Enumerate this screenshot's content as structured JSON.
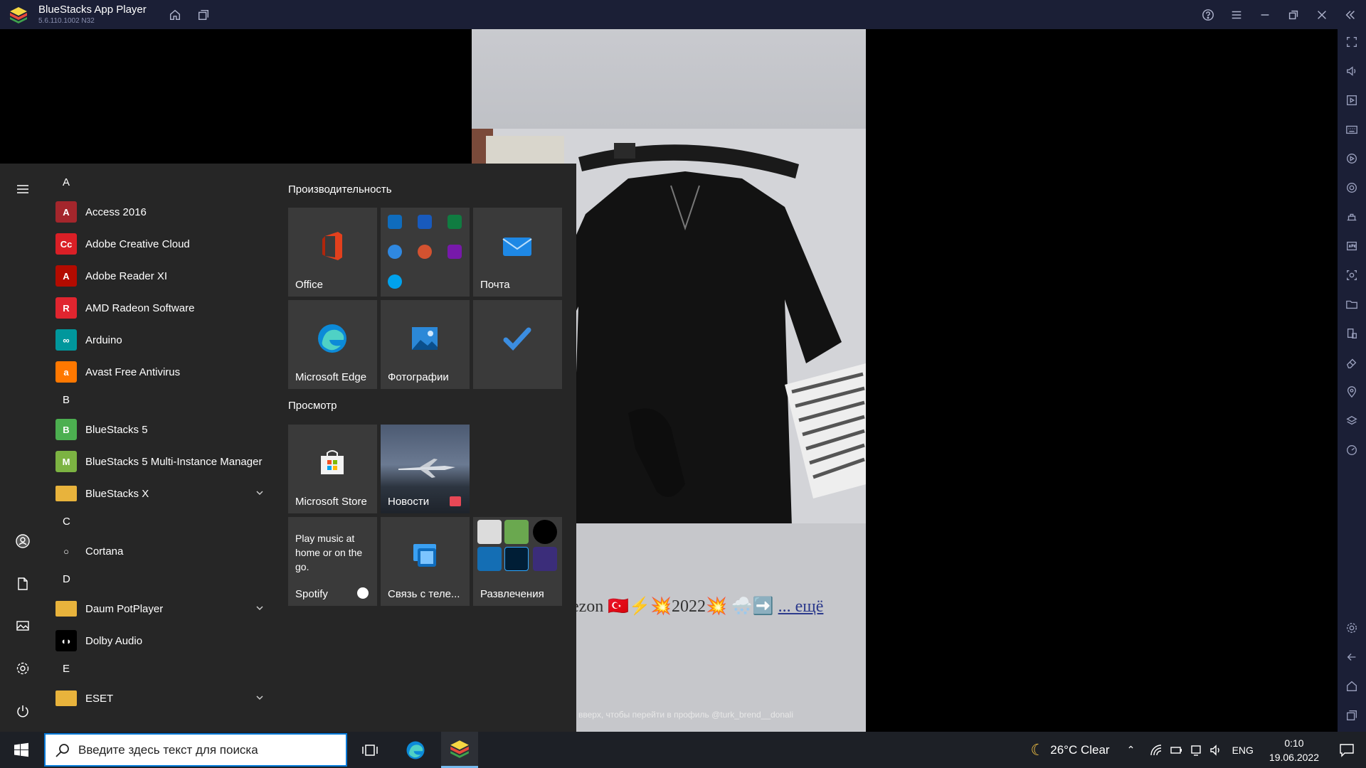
{
  "window": {
    "title": "BlueStacks App Player",
    "version": "5.6.110.1002  N32"
  },
  "emulator": {
    "caption_text": "ezon 🇹🇷⚡💥2022💥 🌨️➡️",
    "caption_more": "... ещё",
    "swipe_hint": "вверх, чтобы перейти в профиль @turk_brend__donali"
  },
  "start_menu": {
    "apps": [
      {
        "type": "letter",
        "text": "A"
      },
      {
        "type": "app",
        "label": "Access 2016",
        "icon": "access-icon",
        "color": "#a4262c",
        "glyph": "A"
      },
      {
        "type": "app",
        "label": "Adobe Creative Cloud",
        "icon": "creative-cloud-icon",
        "color": "#da1f26",
        "glyph": "Cc"
      },
      {
        "type": "app",
        "label": "Adobe Reader XI",
        "icon": "adobe-reader-icon",
        "color": "#b30b00",
        "glyph": "A"
      },
      {
        "type": "app",
        "label": "AMD Radeon Software",
        "icon": "amd-radeon-icon",
        "color": "#e0252f",
        "glyph": "R"
      },
      {
        "type": "app",
        "label": "Arduino",
        "icon": "arduino-icon",
        "color": "#00979c",
        "glyph": "∞"
      },
      {
        "type": "app",
        "label": "Avast Free Antivirus",
        "icon": "avast-icon",
        "color": "#ff7800",
        "glyph": "a"
      },
      {
        "type": "letter",
        "text": "B"
      },
      {
        "type": "app",
        "label": "BlueStacks 5",
        "icon": "bluestacks-icon",
        "color": "#4caf50",
        "glyph": "B"
      },
      {
        "type": "app",
        "label": "BlueStacks 5 Multi-Instance Manager",
        "icon": "bluestacks-mim-icon",
        "color": "#7cb342",
        "glyph": "M"
      },
      {
        "type": "folder",
        "label": "BlueStacks X",
        "icon": "folder-icon",
        "color": "#e8b33c",
        "glyph": ""
      },
      {
        "type": "letter",
        "text": "C"
      },
      {
        "type": "app",
        "label": "Cortana",
        "icon": "cortana-icon",
        "color": "#262626",
        "glyph": "○"
      },
      {
        "type": "letter",
        "text": "D"
      },
      {
        "type": "folder",
        "label": "Daum PotPlayer",
        "icon": "folder-icon",
        "color": "#e8b33c",
        "glyph": ""
      },
      {
        "type": "app",
        "label": "Dolby Audio",
        "icon": "dolby-icon",
        "color": "#000000",
        "glyph": "◖◗"
      },
      {
        "type": "letter",
        "text": "E"
      },
      {
        "type": "folder",
        "label": "ESET",
        "icon": "folder-icon",
        "color": "#e8b33c",
        "glyph": ""
      }
    ],
    "groups": [
      {
        "title": "Производительность"
      },
      {
        "title": "Просмотр"
      }
    ],
    "tiles": {
      "office": "Office",
      "mail": "Почта",
      "edge": "Microsoft Edge",
      "photos": "Фотографии",
      "store": "Microsoft Store",
      "news": "Новости",
      "spotify_desc": "Play music at home or on the go.",
      "spotify": "Spotify",
      "phone": "Связь с теле...",
      "entertainment": "Развлечения"
    }
  },
  "taskbar": {
    "search_placeholder": "Введите здесь текст для поиска",
    "weather": "26°C  Clear",
    "language": "ENG",
    "time": "0:10",
    "date": "19.06.2022"
  },
  "colors": {
    "titlebar": "#1b1f36",
    "start_bg": "#262626",
    "tile_bg": "#3a3a3a",
    "taskbar": "#1d2026",
    "accent": "#0078d7"
  }
}
